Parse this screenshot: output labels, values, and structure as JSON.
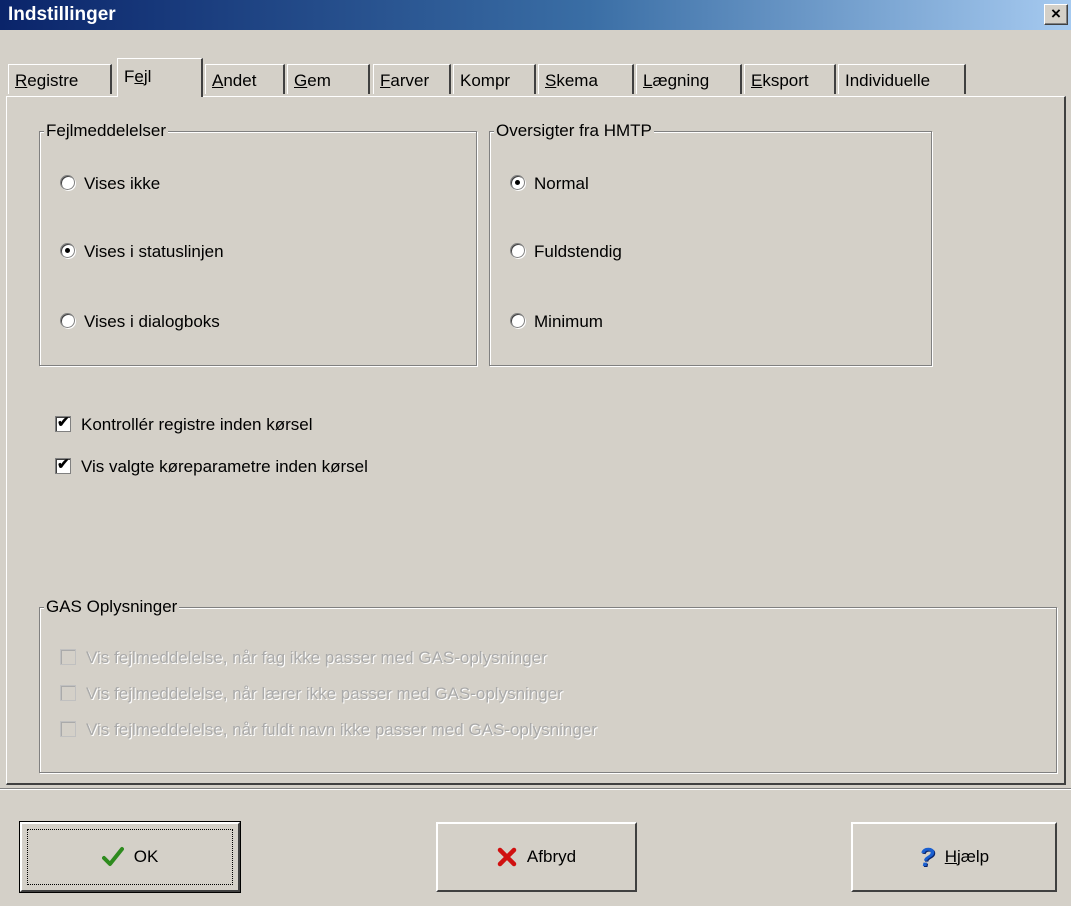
{
  "window": {
    "title": "Indstillinger",
    "close_glyph": "×"
  },
  "tabs": [
    {
      "label_pre": "",
      "label_key": "R",
      "label_post": "egistre"
    },
    {
      "label_pre": "F",
      "label_key": "e",
      "label_post": "jl"
    },
    {
      "label_pre": "",
      "label_key": "A",
      "label_post": "ndet"
    },
    {
      "label_pre": "",
      "label_key": "G",
      "label_post": "em"
    },
    {
      "label_pre": "",
      "label_key": "F",
      "label_post": "arver"
    },
    {
      "label_pre": "Kompr",
      "label_key": "",
      "label_post": ""
    },
    {
      "label_pre": "",
      "label_key": "S",
      "label_post": "kema"
    },
    {
      "label_pre": "",
      "label_key": "L",
      "label_post": "ægning"
    },
    {
      "label_pre": "",
      "label_key": "E",
      "label_post": "ksport"
    },
    {
      "label_pre": "Individuelle",
      "label_key": "",
      "label_post": ""
    }
  ],
  "active_tab": "Fejl",
  "fejlmeddelelser": {
    "title": "Fejlmeddelelser",
    "options": [
      "Vises ikke",
      "Vises i statuslinjen",
      "Vises i dialogboks"
    ],
    "selected": "Vises i statuslinjen"
  },
  "oversigter": {
    "title": "Oversigter fra HMTP",
    "options": [
      "Normal",
      "Fuldstendig",
      "Minimum"
    ],
    "selected": "Normal"
  },
  "checks": [
    {
      "label": "Kontrollér registre inden kørsel",
      "checked": true
    },
    {
      "label": "Vis valgte køreparametre inden kørsel",
      "checked": true
    }
  ],
  "gas": {
    "title": "GAS Oplysninger",
    "options": [
      {
        "label": "Vis fejlmeddelelse, når fag ikke passer med GAS-oplysninger",
        "checked": false,
        "enabled": false
      },
      {
        "label": "Vis fejlmeddelelse, når lærer ikke passer med GAS-oplysninger",
        "checked": false,
        "enabled": false
      },
      {
        "label": "Vis fejlmeddelelse, når fuldt navn ikke passer med GAS-oplysninger",
        "checked": false,
        "enabled": false
      }
    ]
  },
  "buttons": {
    "ok": {
      "label": "OK",
      "icon": "checkmark-icon",
      "color": "#2e8b1e"
    },
    "cancel": {
      "label": "Afbryd",
      "icon": "red-x-icon",
      "color": "#d01010"
    },
    "help": {
      "label_key": "H",
      "label_post": "jælp",
      "icon": "question-mark-icon",
      "color": "#1a5fd0"
    }
  }
}
